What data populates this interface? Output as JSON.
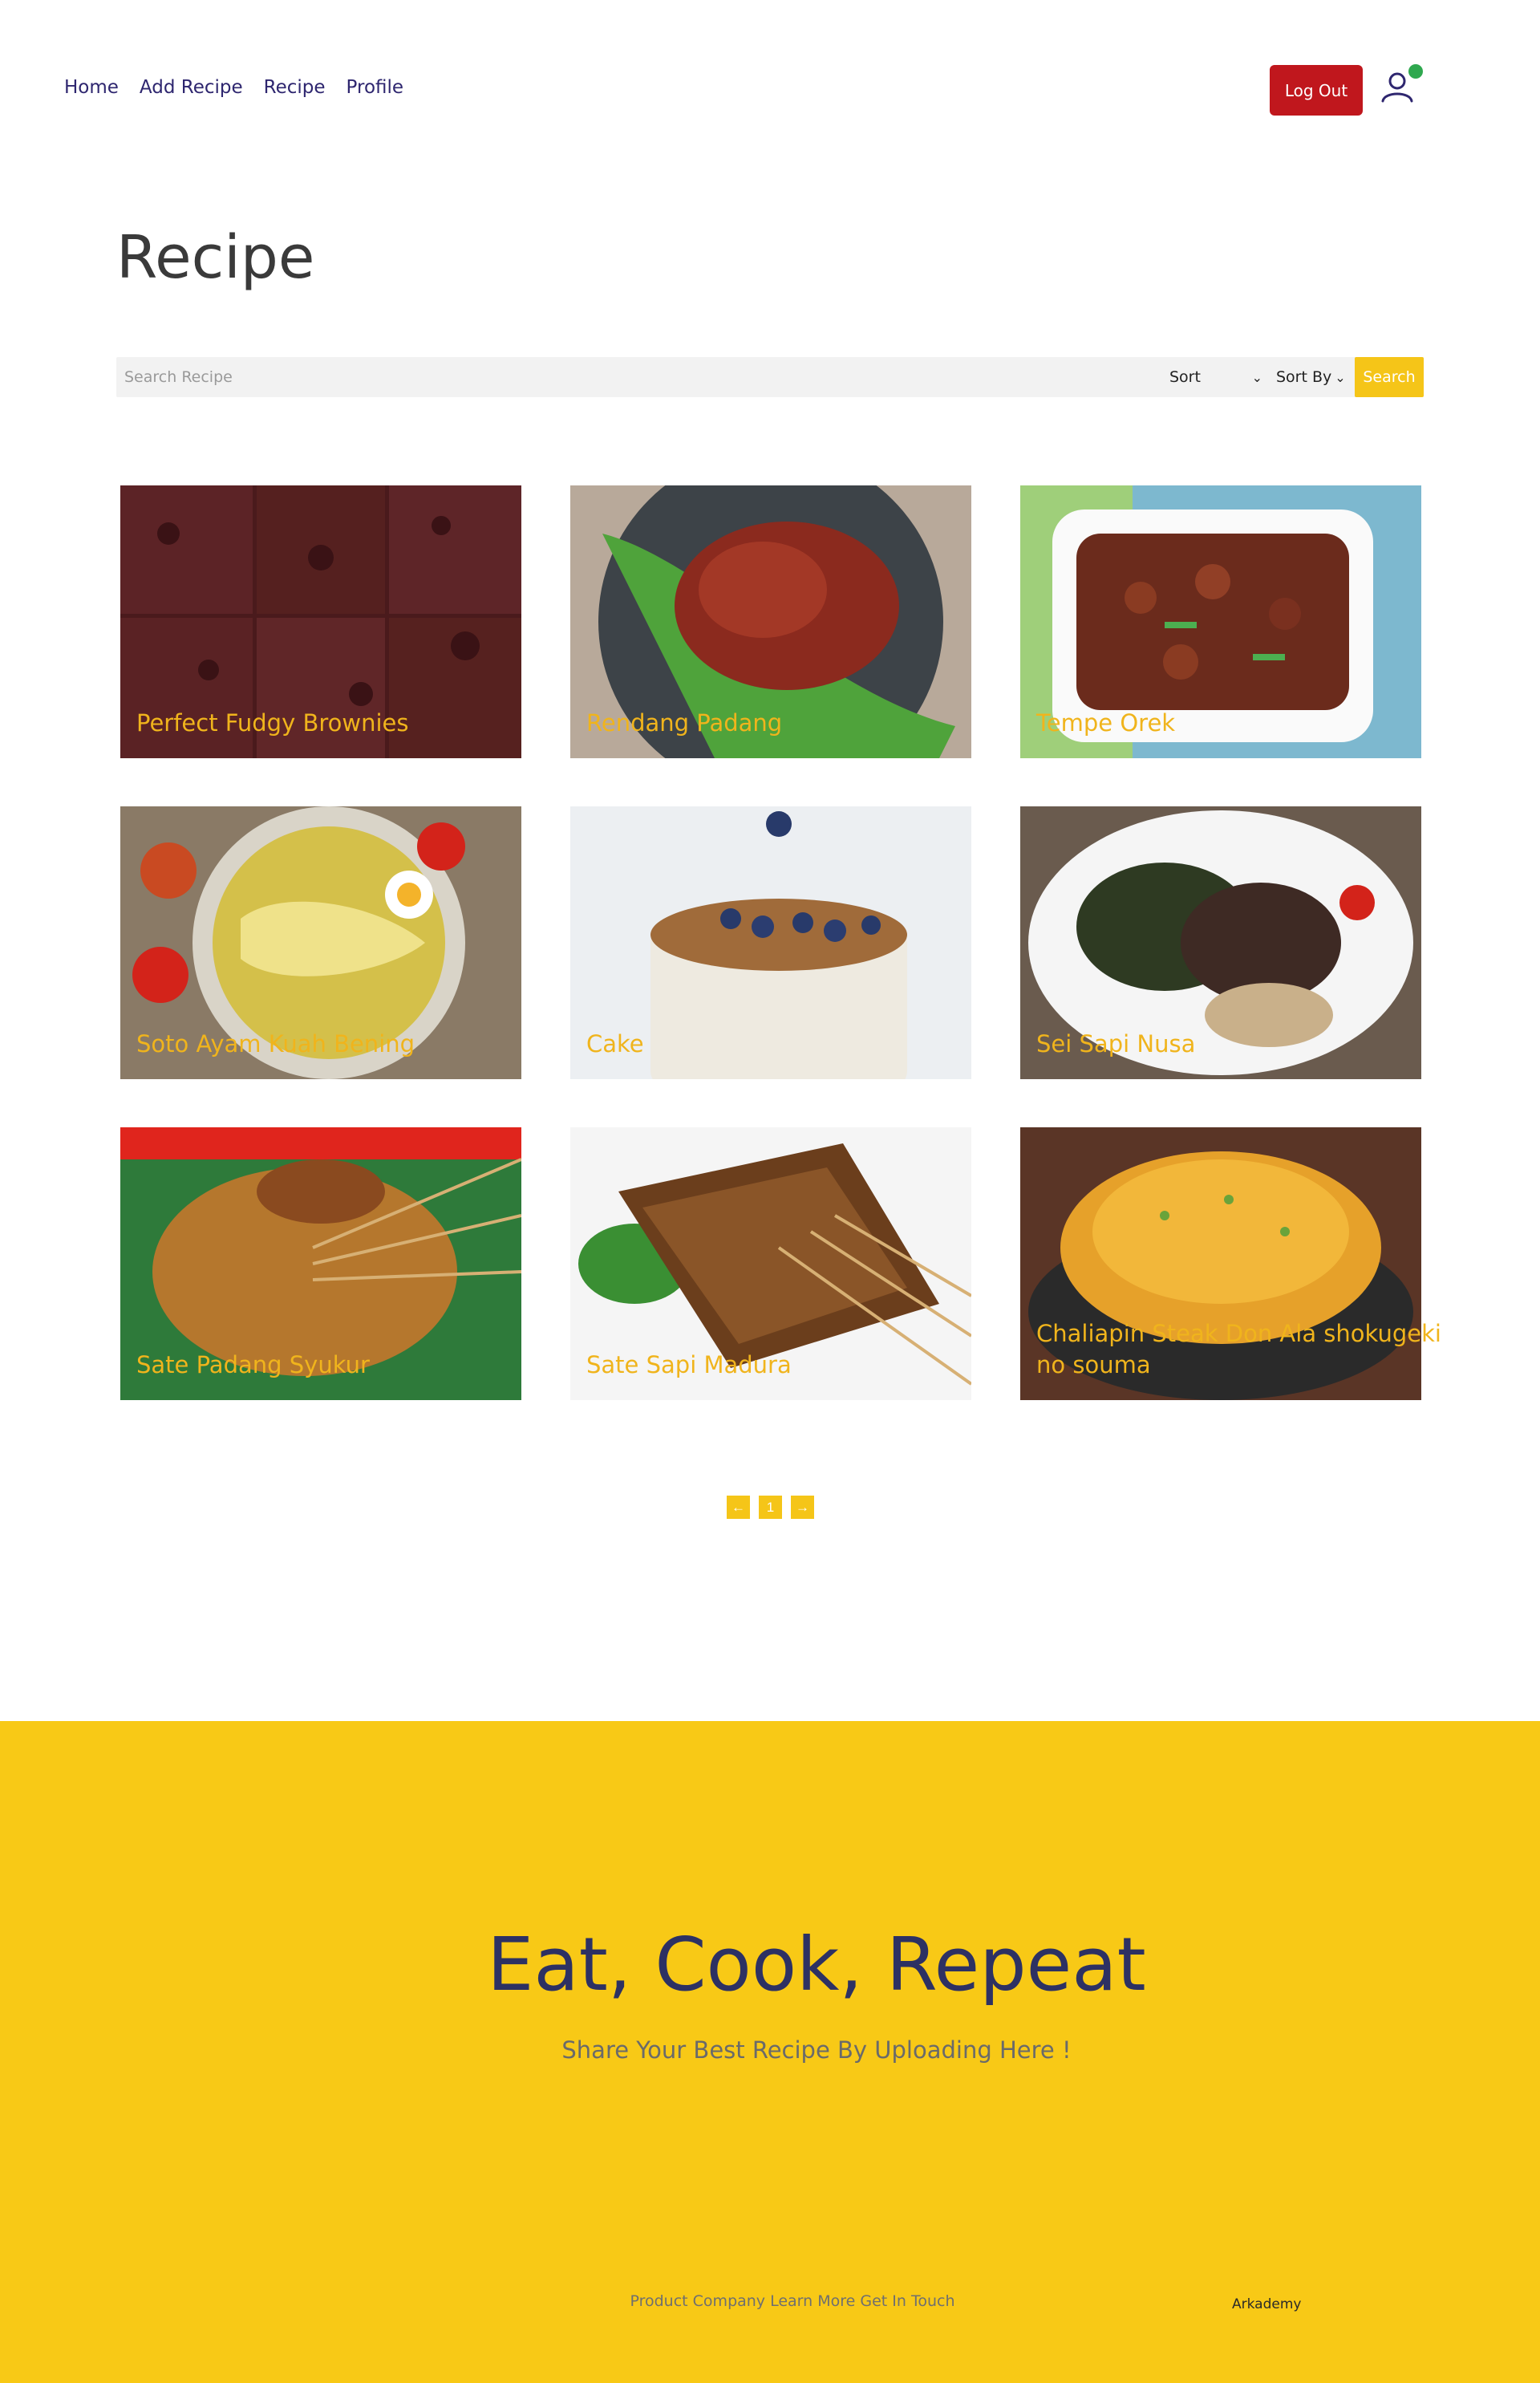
{
  "nav": {
    "links": [
      "Home",
      "Add Recipe",
      "Recipe",
      "Profile"
    ],
    "logout_label": "Log Out",
    "user_icon": "user-outline-icon",
    "online_status_color": "#2fa84f"
  },
  "page": {
    "title": "Recipe"
  },
  "search": {
    "placeholder": "Search Recipe",
    "value": "",
    "sort_label": "Sort",
    "sort_by_label": "Sort By",
    "button_label": "Search"
  },
  "recipes": [
    {
      "title": "Perfect Fudgy Brownies"
    },
    {
      "title": "Rendang Padang"
    },
    {
      "title": "Tempe Orek"
    },
    {
      "title": "Soto Ayam Kuah Bening"
    },
    {
      "title": "Cake"
    },
    {
      "title": "Sei Sapi Nusa"
    },
    {
      "title": "Sate Padang Syukur"
    },
    {
      "title": "Sate Sapi Madura"
    },
    {
      "title": "Chaliapin Steak Don Ala shokugeki no souma"
    }
  ],
  "pagination": {
    "prev_icon": "arrow-left-icon",
    "current": "1",
    "next_icon": "arrow-right-icon"
  },
  "footer": {
    "title": "Eat, Cook, Repeat",
    "subtitle": "Share Your Best Recipe By Uploading Here !",
    "links": "Product Company Learn More Get In Touch",
    "brand": "Arkademy"
  },
  "colors": {
    "accent_yellow": "#f5c518",
    "footer_yellow": "#f8c916",
    "logout_red": "#c0171d",
    "nav_text": "#2e266f",
    "card_title": "#f0b41c"
  }
}
